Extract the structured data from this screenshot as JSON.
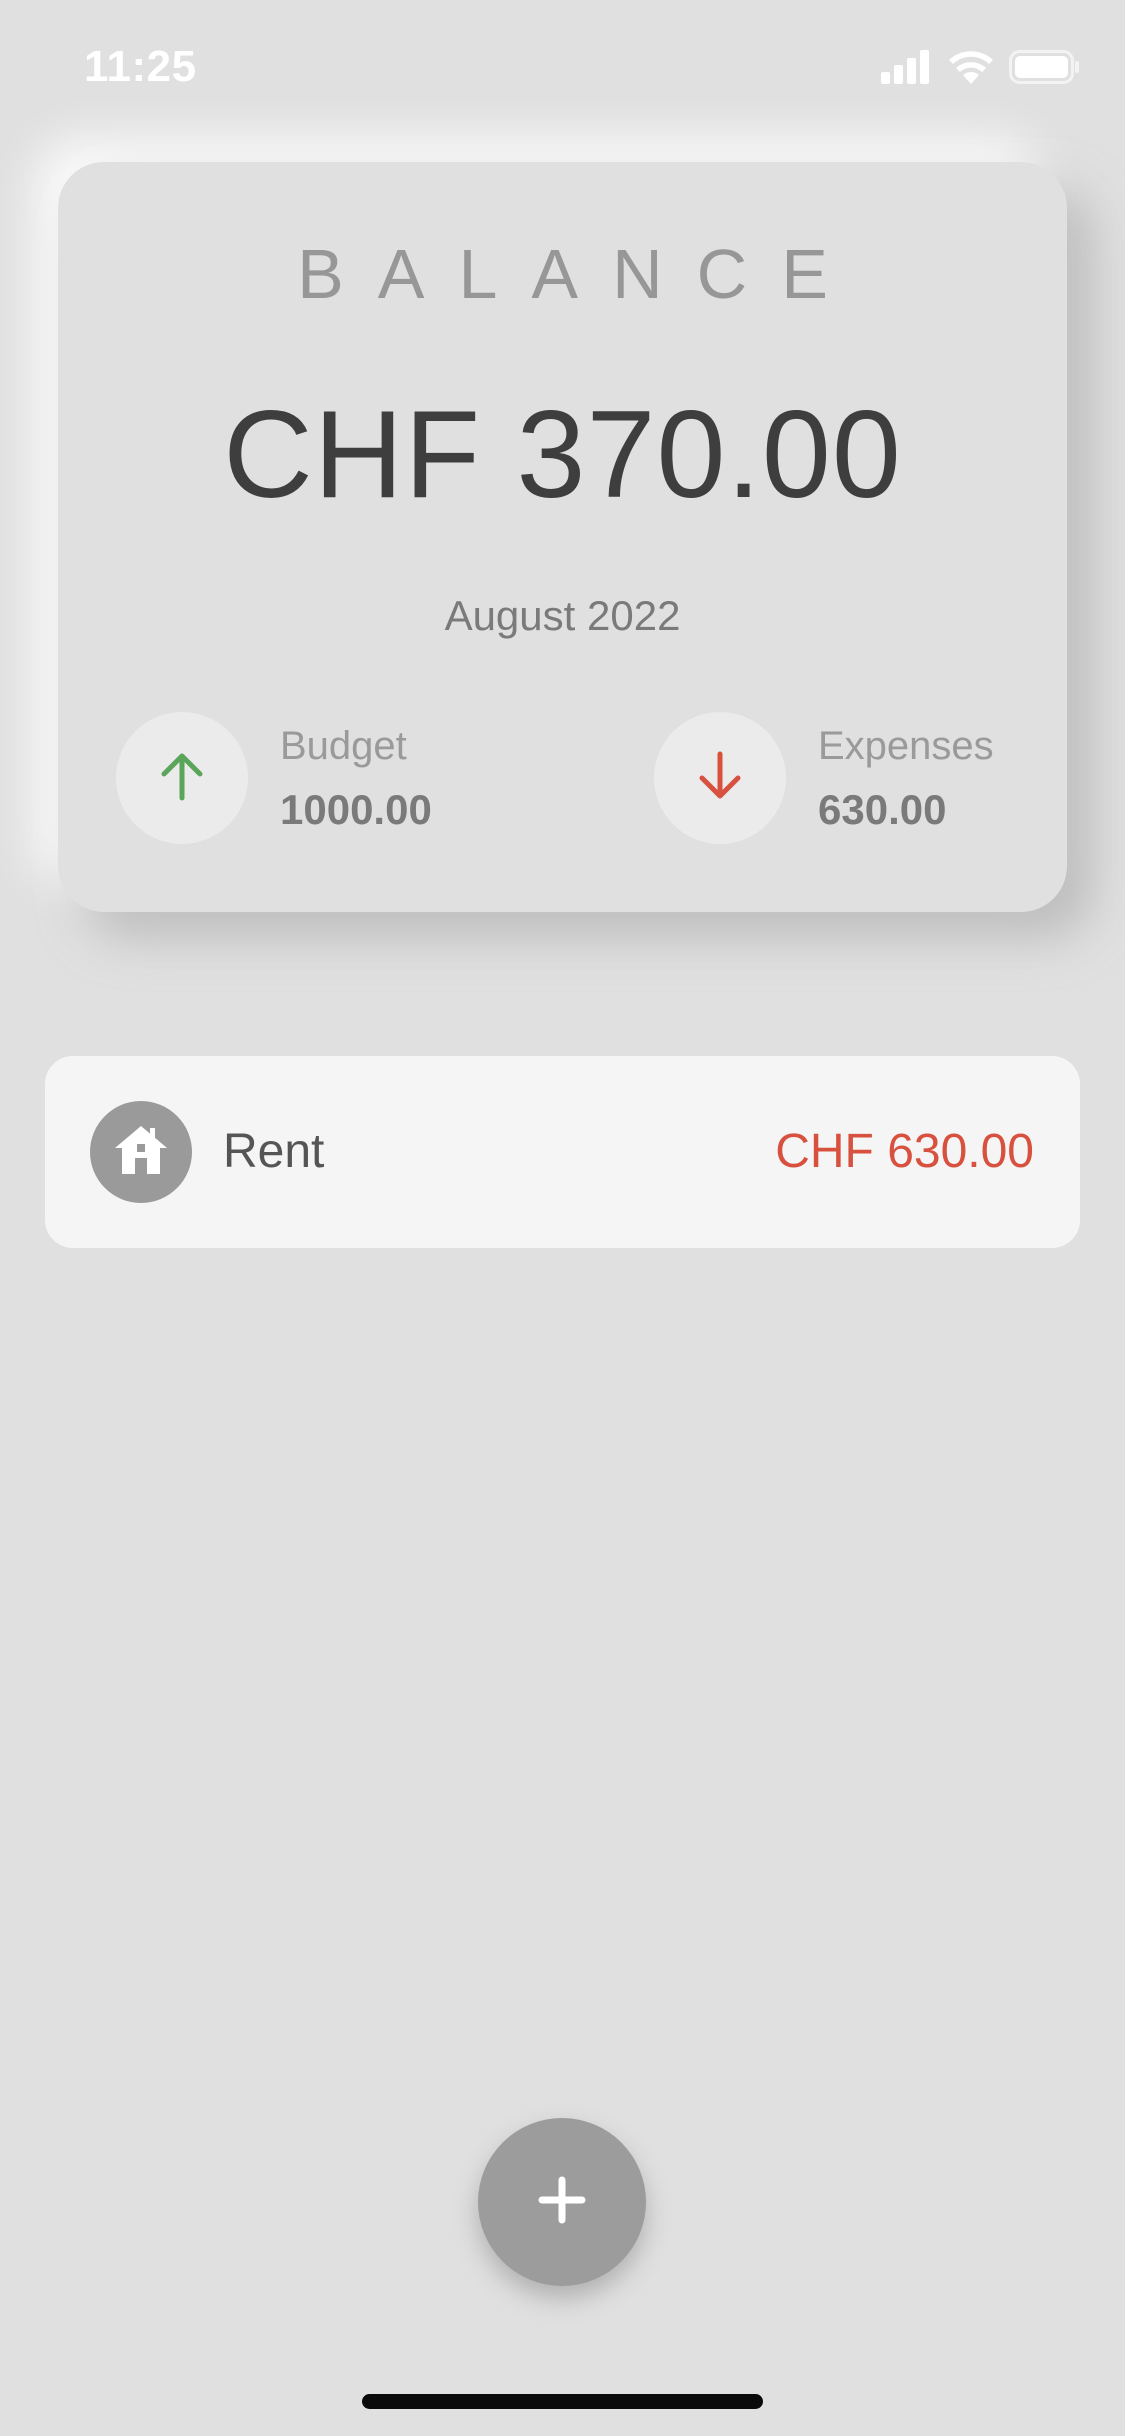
{
  "status_bar": {
    "time": "11:25",
    "icons": [
      "cellular-signal-icon",
      "wifi-icon",
      "battery-icon"
    ]
  },
  "balance_card": {
    "heading": "BALANCE",
    "amount": "CHF 370.00",
    "month": "August 2022",
    "budget": {
      "label": "Budget",
      "value": "1000.00",
      "icon": "arrow-up-icon",
      "color": "#5aa55a"
    },
    "expenses": {
      "label": "Expenses",
      "value": "630.00",
      "icon": "arrow-down-icon",
      "color": "#d8513f"
    }
  },
  "transactions": [
    {
      "name": "Rent",
      "amount": "CHF 630.00",
      "icon": "home-icon",
      "amount_color": "#d8513f"
    }
  ],
  "fab": {
    "label": "+",
    "icon": "plus-icon"
  },
  "colors": {
    "background": "#e0e0e0",
    "card": "#f5f5f5",
    "accent_positive": "#5aa55a",
    "accent_negative": "#d8513f"
  }
}
